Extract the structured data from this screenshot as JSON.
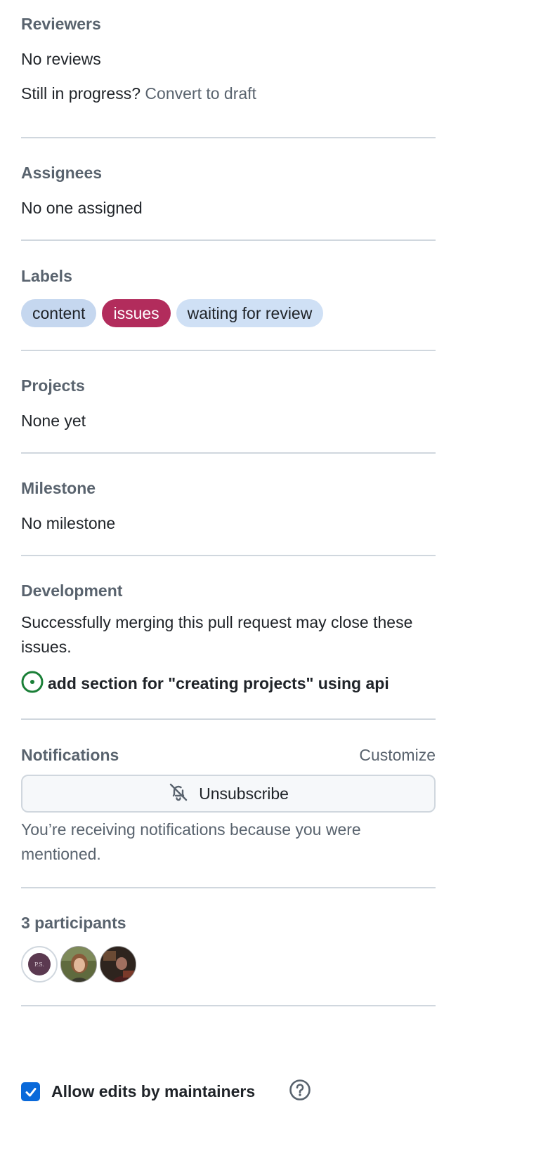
{
  "reviewers": {
    "heading": "Reviewers",
    "value": "No reviews",
    "draft_prompt": "Still in progress?",
    "draft_link": "Convert to draft"
  },
  "assignees": {
    "heading": "Assignees",
    "value": "No one assigned"
  },
  "labels": {
    "heading": "Labels",
    "items": [
      {
        "name": "content",
        "bg": "#c5d7ef",
        "fg": "#1f2328"
      },
      {
        "name": "issues",
        "bg": "#b22c5c",
        "fg": "#ffffff"
      },
      {
        "name": "waiting for review",
        "bg": "#cfe0f5",
        "fg": "#1f2328"
      }
    ]
  },
  "projects": {
    "heading": "Projects",
    "value": "None yet"
  },
  "milestone": {
    "heading": "Milestone",
    "value": "No milestone"
  },
  "development": {
    "heading": "Development",
    "description": "Successfully merging this pull request may close these issues.",
    "issue_title": "add section for \"creating projects\" using api",
    "issue_icon": "issue-opened-icon",
    "issue_icon_color": "#1a7f37"
  },
  "notifications": {
    "heading": "Notifications",
    "customize": "Customize",
    "button_label": "Unsubscribe",
    "button_icon": "bell-slash-icon",
    "note": "You’re receiving notifications because you were mentioned."
  },
  "participants": {
    "heading": "3 participants",
    "avatars": [
      {
        "initials": "P.S."
      },
      {},
      {}
    ]
  },
  "maintainers": {
    "label": "Allow edits by maintainers",
    "checked": true,
    "help_icon": "question-icon"
  },
  "colors": {
    "accent": "#0969da",
    "muted": "#59636e",
    "border": "#d0d7de"
  }
}
